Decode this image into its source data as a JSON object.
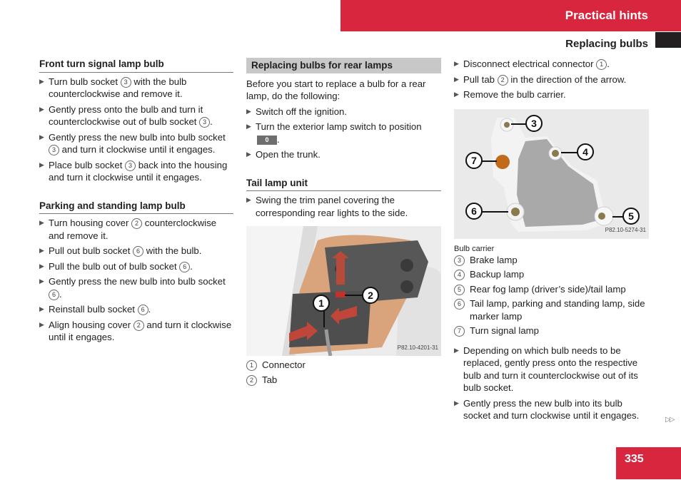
{
  "header": {
    "section": "Practical hints",
    "subsection": "Replacing bulbs"
  },
  "col1": {
    "front": {
      "heading": "Front turn signal lamp bulb",
      "steps": [
        {
          "pre": "Turn bulb socket ",
          "ref": "3",
          "post": " with the bulb counterclockwise and remove it."
        },
        {
          "pre": "Gently press onto the bulb and turn it counterclockwise out of bulb socket ",
          "ref": "3",
          "post": "."
        },
        {
          "pre": "Gently press the new bulb into bulb socket ",
          "ref": "3",
          "post": " and turn it clockwise until it engages."
        },
        {
          "pre": "Place bulb socket ",
          "ref": "3",
          "post": " back into the housing and turn it clockwise until it engages."
        }
      ]
    },
    "parking": {
      "heading": "Parking and standing lamp bulb",
      "steps": [
        {
          "pre": "Turn housing cover ",
          "ref": "2",
          "post": " counterclockwise and remove it."
        },
        {
          "pre": "Pull out bulb socket ",
          "ref": "6",
          "post": " with the bulb."
        },
        {
          "pre": "Pull the bulb out of bulb socket ",
          "ref": "6",
          "post": "."
        },
        {
          "pre": "Gently press the new bulb into bulb socket ",
          "ref": "6",
          "post": "."
        },
        {
          "pre": "Reinstall bulb socket ",
          "ref": "6",
          "post": "."
        },
        {
          "pre": "Align housing cover ",
          "ref": "2",
          "post": " and turn it clockwise until it engages."
        }
      ]
    }
  },
  "col2": {
    "rear_heading": "Replacing bulbs for rear lamps",
    "intro": "Before you start to replace a bulb for a rear lamp, do the following:",
    "steps": [
      "Switch off the ignition.",
      "Turn the exterior lamp switch to position",
      "Open the trunk."
    ],
    "switch_position": "0",
    "tail_heading": "Tail lamp unit",
    "tail_steps": [
      "Swing the trim panel covering the corresponding rear lights to the side."
    ],
    "figure1": {
      "code": "P82.10-4201-31",
      "callouts": [
        "1",
        "2"
      ],
      "legend": [
        {
          "ref": "1",
          "label": "Connector"
        },
        {
          "ref": "2",
          "label": "Tab"
        }
      ]
    }
  },
  "col3": {
    "steps": [
      {
        "pre": "Disconnect electrical connector ",
        "ref": "1",
        "post": "."
      },
      {
        "pre": "Pull tab ",
        "ref": "2",
        "post": " in the direction of the arrow."
      },
      {
        "pre": "Remove the bulb carrier.",
        "ref": "",
        "post": ""
      }
    ],
    "figure2": {
      "code": "P82.10-5274-31",
      "caption": "Bulb carrier",
      "callouts": [
        "3",
        "4",
        "5",
        "6",
        "7"
      ],
      "legend": [
        {
          "ref": "3",
          "label": "Brake lamp"
        },
        {
          "ref": "4",
          "label": "Backup lamp"
        },
        {
          "ref": "5",
          "label": "Rear fog lamp (driver’s side)/tail lamp"
        },
        {
          "ref": "6",
          "label": "Tail lamp, parking and standing lamp, side marker lamp"
        },
        {
          "ref": "7",
          "label": "Turn signal lamp"
        }
      ]
    },
    "final_steps": [
      "Depending on which bulb needs to be replaced, gently press onto the respective bulb and turn it counterclockwise out of its bulb socket.",
      "Gently press the new bulb into its bulb socket and turn clockwise until it engages."
    ]
  },
  "footer": {
    "page_number": "335",
    "continue_icon": "▷▷"
  },
  "colors": {
    "accent": "#d8263f",
    "heading_shade": "#c8c8c8",
    "switch_badge": "#6e6e6e"
  }
}
